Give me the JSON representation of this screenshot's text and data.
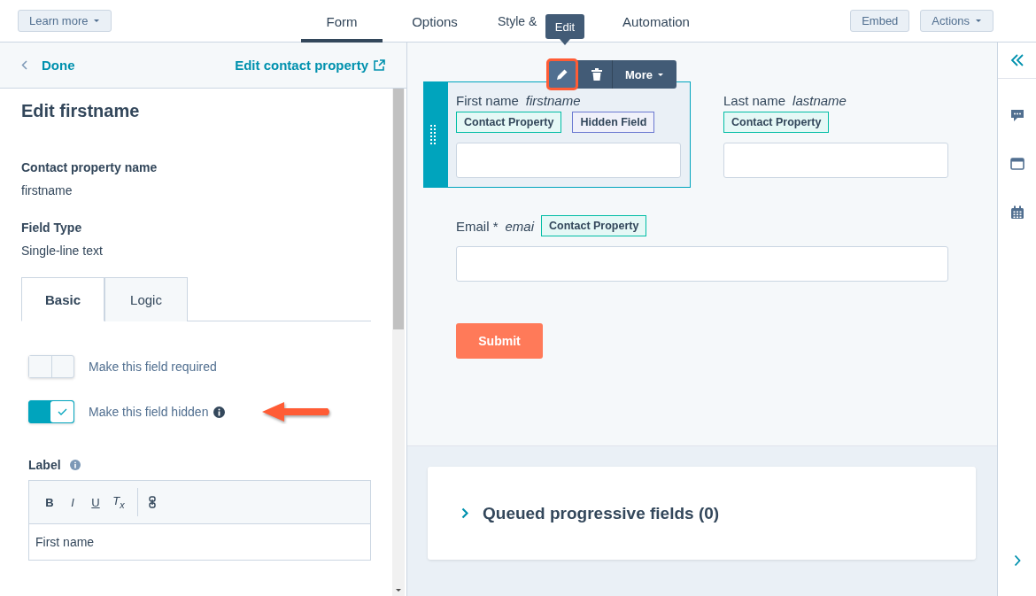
{
  "top_bar": {
    "learn_more": "Learn more",
    "tabs": [
      {
        "label": "Form",
        "selected": true
      },
      {
        "label": "Options",
        "selected": false
      },
      {
        "label": "Style &",
        "selected": false
      },
      {
        "label": "Automation",
        "selected": false
      }
    ],
    "buttons": [
      {
        "label": "Embed",
        "caret": false
      },
      {
        "label": "Actions",
        "caret": true
      }
    ]
  },
  "sidebar": {
    "back": "Done",
    "edit_link": "Edit contact property",
    "title": "Edit firstname",
    "details": [
      {
        "label": "Contact property name",
        "value": "firstname"
      },
      {
        "label": "Field Type",
        "value": "Single-line text"
      }
    ],
    "tabs": [
      {
        "label": "Basic",
        "selected": true
      },
      {
        "label": "Logic",
        "selected": false
      }
    ],
    "toggles": [
      {
        "label": "Make this field required",
        "on": false,
        "info": false
      },
      {
        "label": "Make this field hidden",
        "on": true,
        "info": true
      }
    ],
    "label_field": {
      "label": "Label",
      "tools": [
        "B",
        "I",
        "U",
        "T$_{x}$"
      ],
      "value": "First name"
    }
  },
  "canvas": {
    "tooltip": "Edit",
    "more": "More",
    "rows": [
      [
        {
          "label": "First name",
          "name": "firstname",
          "selected": true,
          "tags": [
            {
              "text": "Contact Property",
              "kind": "property"
            },
            {
              "text": "Hidden Field",
              "kind": "hidden"
            }
          ]
        },
        {
          "label": "Last name",
          "name": "lastname",
          "selected": false,
          "tags": [
            {
              "text": "Contact Property",
              "kind": "property"
            }
          ]
        }
      ],
      [
        {
          "label": "Email *",
          "name": "emai",
          "selected": false,
          "tags": [
            {
              "text": "Contact Property",
              "kind": "property"
            }
          ]
        }
      ]
    ],
    "submit": "Submit",
    "queued": "Queued progressive fields (0)"
  }
}
